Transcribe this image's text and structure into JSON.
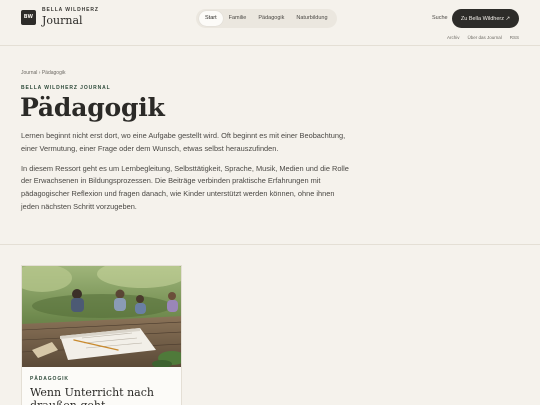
{
  "header": {
    "logo_mark": "BW",
    "brand": "BELLA WILDHERZ",
    "site_title": "Journal",
    "nav": [
      {
        "label": "Start",
        "active": true
      },
      {
        "label": "Familie",
        "active": false
      },
      {
        "label": "Pädagogik",
        "active": false
      },
      {
        "label": "Naturbildung",
        "active": false
      }
    ],
    "search_label": "Suche",
    "cta_label": "Zu Bella Wildherz ↗",
    "sublinks": [
      "Archiv",
      "Über das Journal",
      "RSS"
    ]
  },
  "main": {
    "breadcrumb": "Journal › Pädagogik",
    "eyebrow": "BELLA WILDHERZ JOURNAL",
    "title": "Pädagogik",
    "intro": [
      "Lernen beginnt nicht erst dort, wo eine Aufgabe gestellt wird. Oft beginnt es mit einer Beobachtung, einer Vermutung, einer Frage oder dem Wunsch, etwas selbst herauszufinden.",
      "In diesem Ressort geht es um Lernbegleitung, Selbsttätigkeit, Sprache, Musik, Medien und die Rolle der Erwachsenen in Bildungsprozessen. Die Beiträge verbinden praktische Erfahrungen mit pädagogischer Reflexion und fragen danach, wie Kinder unterstützt werden können, ohne ihnen jeden nächsten Schritt vorzugeben."
    ]
  },
  "card": {
    "tag": "PÄDAGOGIK",
    "title": "Wenn Unterricht nach draußen geht"
  }
}
